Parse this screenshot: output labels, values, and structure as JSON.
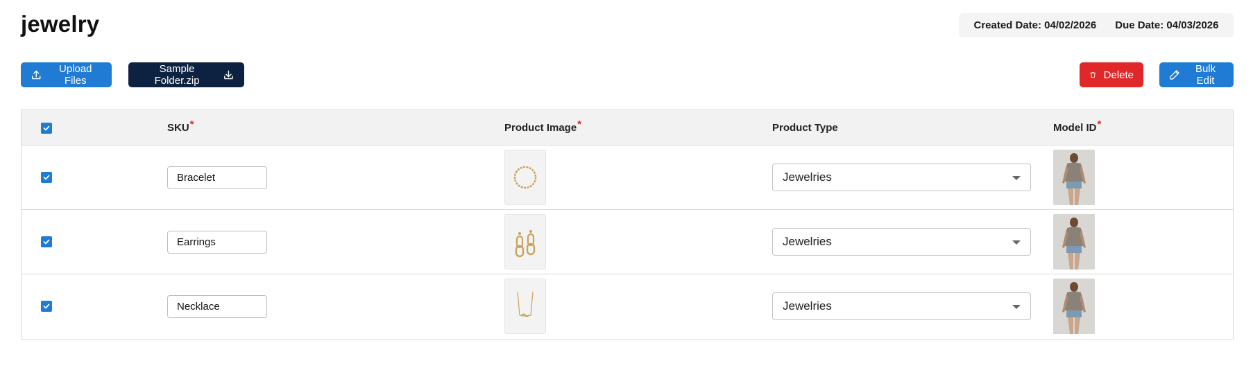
{
  "page": {
    "title": "jewelry"
  },
  "dates": {
    "created": "Created Date: 04/02/2026",
    "due": "Due Date: 04/03/2026"
  },
  "toolbar": {
    "upload_label": "Upload Files",
    "zip_label": "Sample Folder.zip",
    "delete_label": "Delete",
    "bulk_edit_label": "Bulk Edit"
  },
  "table": {
    "headers": {
      "sku": "SKU",
      "product_image": "Product Image",
      "product_type": "Product Type",
      "model_id": "Model ID"
    },
    "required_mark": "*",
    "rows": [
      {
        "sku": "Bracelet",
        "product_type": "Jewelries",
        "checked": true,
        "image_icon": "bracelet-image"
      },
      {
        "sku": "Earrings",
        "product_type": "Jewelries",
        "checked": true,
        "image_icon": "earrings-image"
      },
      {
        "sku": "Necklace",
        "product_type": "Jewelries",
        "checked": true,
        "image_icon": "necklace-image"
      }
    ]
  },
  "colors": {
    "primary": "#1f7bd4",
    "dark": "#0d2240",
    "danger": "#e02828",
    "required": "#e02828"
  }
}
